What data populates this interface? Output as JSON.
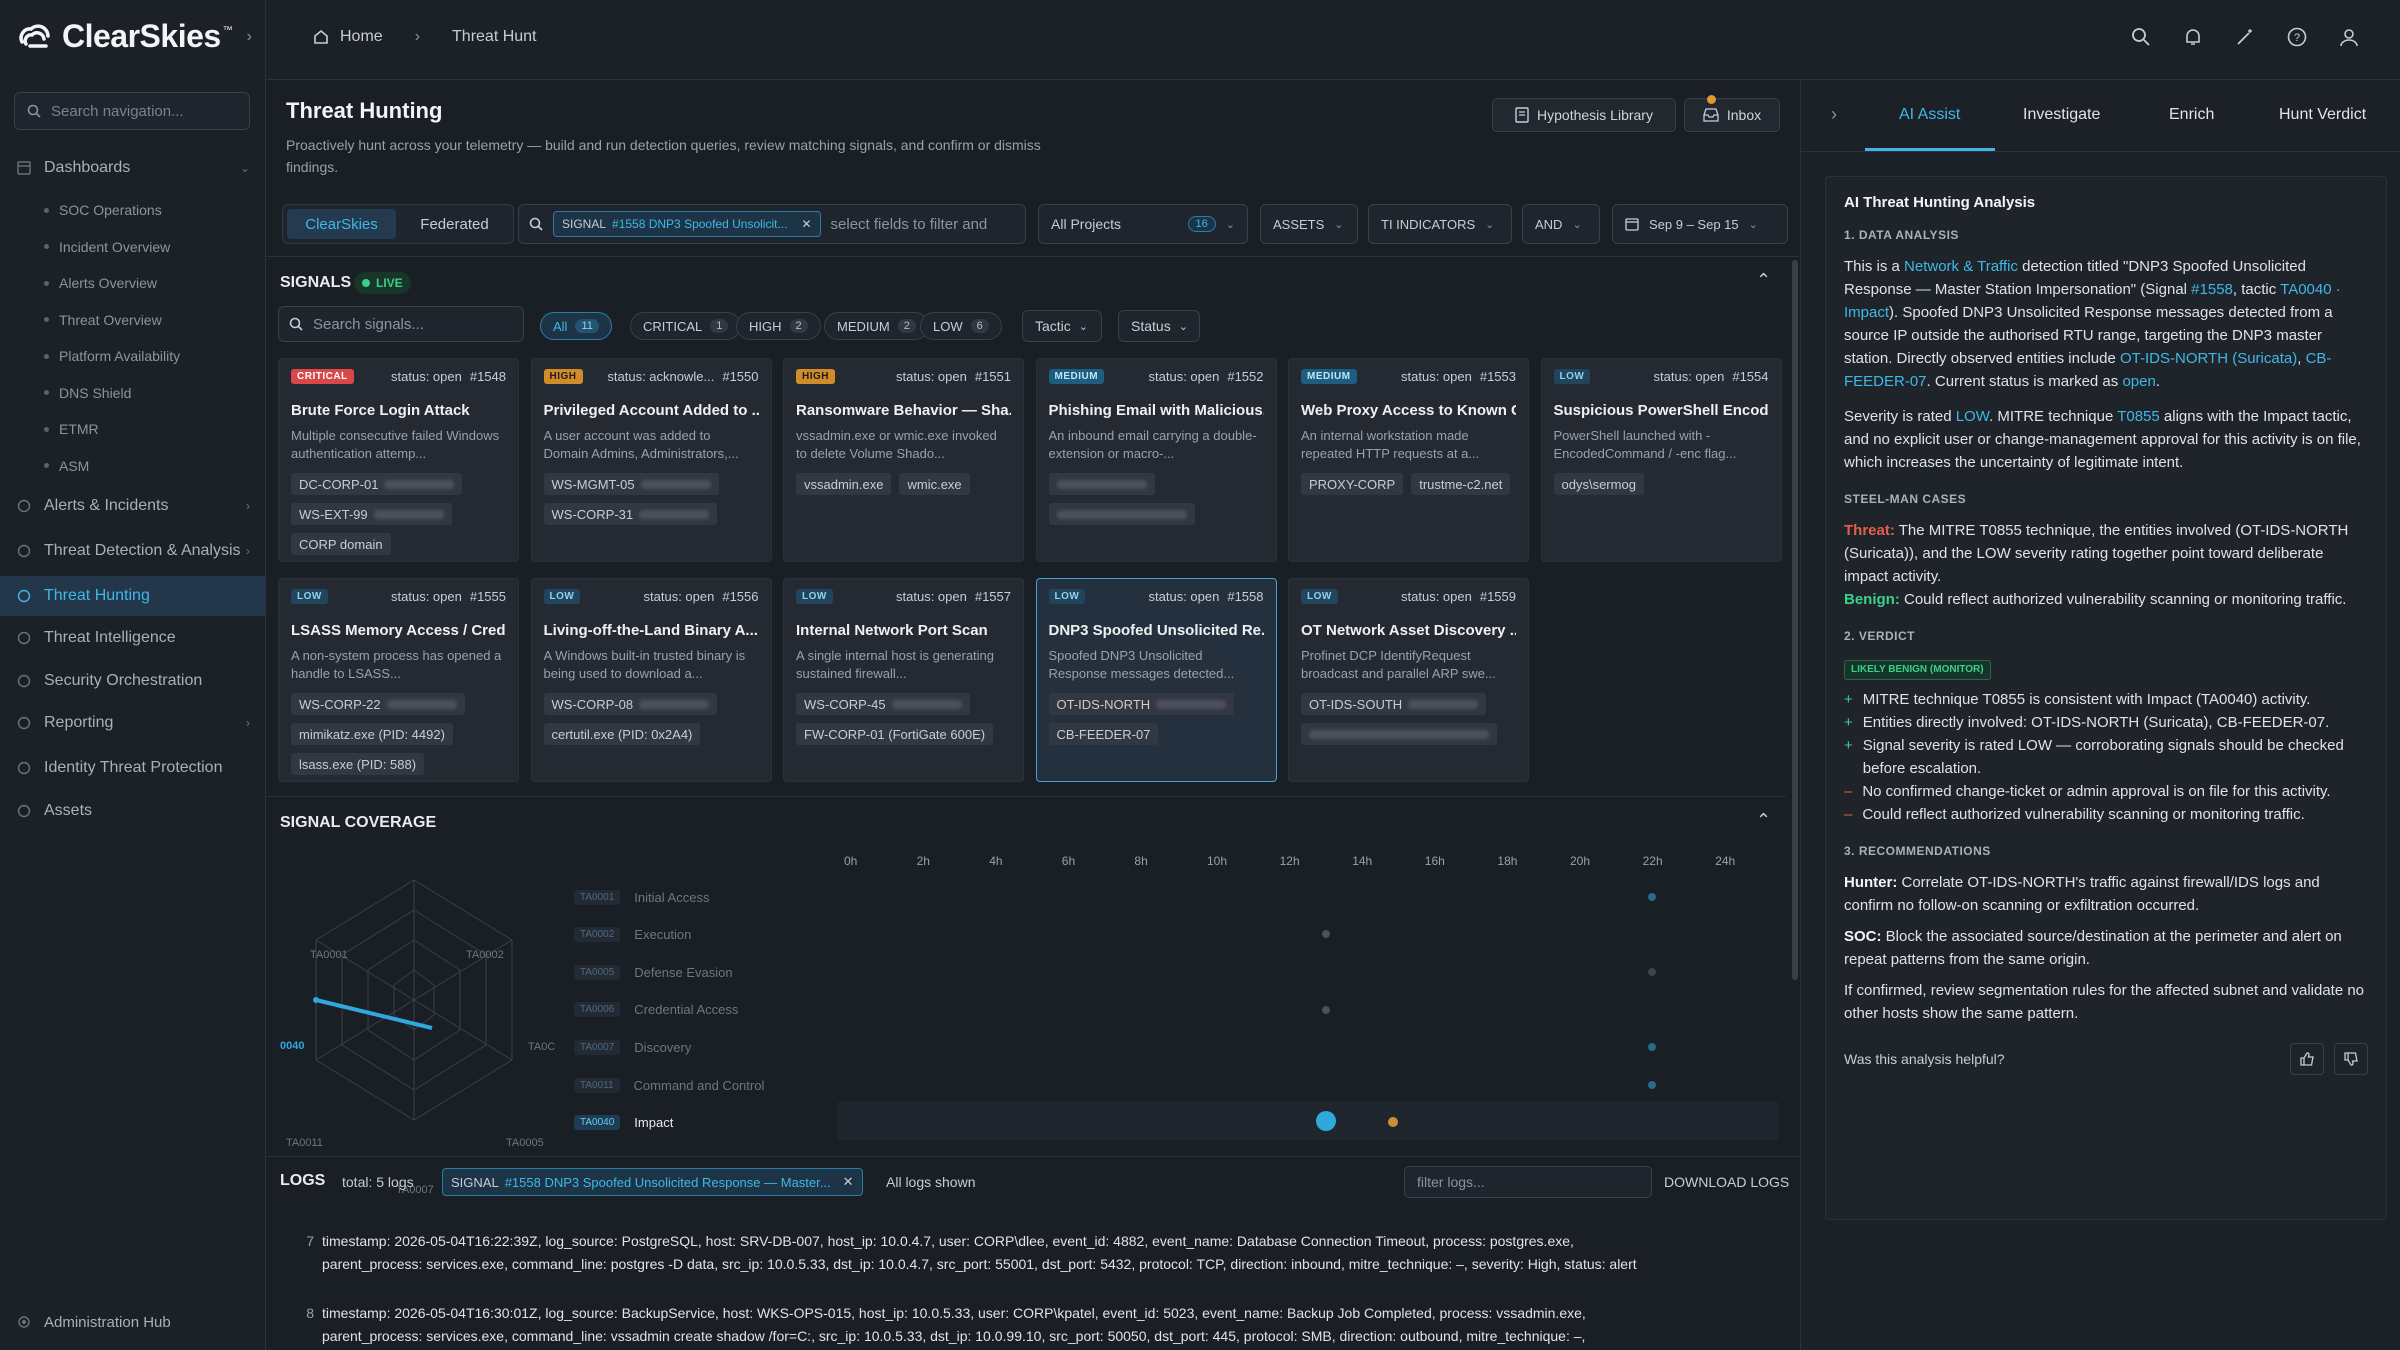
{
  "app": {
    "name": "ClearSkies",
    "tm": "™"
  },
  "nav": {
    "search_placeholder": "Search navigation...",
    "dashboards": "Dashboards",
    "dashboard_items": [
      "SOC Operations",
      "Incident Overview",
      "Alerts Overview",
      "Threat Overview",
      "Platform Availability",
      "DNS Shield",
      "ETMR",
      "ASM"
    ],
    "items": [
      "Alerts & Incidents",
      "Threat Detection & Analysis",
      "Threat Hunting",
      "Threat Intelligence",
      "Security Orchestration",
      "Reporting",
      "Identity Threat Protection",
      "Assets"
    ],
    "footer": "Administration Hub"
  },
  "breadcrumb": {
    "home": "Home",
    "current": "Threat Hunt"
  },
  "page": {
    "title": "Threat Hunting",
    "subtitle": "Proactively hunt across your telemetry — build and run detection queries, review matching signals, and confirm or dismiss findings.",
    "hypothesis_btn": "Hypothesis Library",
    "inbox_btn": "Inbox"
  },
  "filters": {
    "seg": [
      "ClearSkies",
      "Federated"
    ],
    "chip_key": "SIGNAL",
    "chip_val": "#1558 DNP3 Spoofed Unsolicit...",
    "filter_placeholder": "select fields to filter and",
    "projects": "All Projects",
    "projects_count": "16",
    "assets": "ASSETS",
    "ti": "TI INDICATORS",
    "and": "AND",
    "date": "Sep 9 – Sep 15"
  },
  "signals": {
    "title": "SIGNALS",
    "live": "LIVE",
    "search_placeholder": "Search signals...",
    "pills": [
      {
        "l": "All",
        "n": "11"
      },
      {
        "l": "CRITICAL",
        "n": "1"
      },
      {
        "l": "HIGH",
        "n": "2"
      },
      {
        "l": "MEDIUM",
        "n": "2"
      },
      {
        "l": "LOW",
        "n": "6"
      }
    ],
    "tactic": "Tactic",
    "status": "Status",
    "cards": [
      {
        "sev": "CRITICAL",
        "status": "status: open",
        "id": "#1548",
        "title": "Brute Force Login Attack",
        "desc": "Multiple consecutive failed Windows authentication attemp...",
        "ents": [
          "DC-CORP-01",
          "WS-EXT-99",
          "CORP domain"
        ]
      },
      {
        "sev": "HIGH",
        "status": "status: acknowle...",
        "id": "#1550",
        "title": "Privileged Account Added to ...",
        "desc": "A user account was added to Domain Admins, Administrators,...",
        "ents": [
          "WS-MGMT-05",
          "WS-CORP-31"
        ]
      },
      {
        "sev": "HIGH",
        "status": "status: open",
        "id": "#1551",
        "title": "Ransomware Behavior — Sha...",
        "desc": "vssadmin.exe or wmic.exe invoked to delete Volume Shado...",
        "ents": [
          "vssadmin.exe",
          "wmic.exe"
        ]
      },
      {
        "sev": "MEDIUM",
        "status": "status: open",
        "id": "#1552",
        "title": "Phishing Email with Malicious...",
        "desc": "An inbound email carrying a double-extension or macro-...",
        "ents": []
      },
      {
        "sev": "MEDIUM",
        "status": "status: open",
        "id": "#1553",
        "title": "Web Proxy Access to Known C...",
        "desc": "An internal workstation made repeated HTTP requests at a...",
        "ents": [
          "PROXY-CORP",
          "trustme-c2.net"
        ]
      },
      {
        "sev": "LOW",
        "status": "status: open",
        "id": "#1554",
        "title": "Suspicious PowerShell Encod...",
        "desc": "PowerShell launched with -EncodedCommand / -enc flag...",
        "ents": [
          "odys\\sermog"
        ]
      },
      {
        "sev": "LOW",
        "status": "status: open",
        "id": "#1555",
        "title": "LSASS Memory Access / Cred...",
        "desc": "A non-system process has opened a handle to LSASS...",
        "ents": [
          "WS-CORP-22",
          "mimikatz.exe (PID: 4492)",
          "lsass.exe (PID: 588)"
        ]
      },
      {
        "sev": "LOW",
        "status": "status: open",
        "id": "#1556",
        "title": "Living-off-the-Land Binary A...",
        "desc": "A Windows built-in trusted binary is being used to download a...",
        "ents": [
          "WS-CORP-08",
          "certutil.exe (PID: 0x2A4)"
        ]
      },
      {
        "sev": "LOW",
        "status": "status: open",
        "id": "#1557",
        "title": "Internal Network Port Scan",
        "desc": "A single internal host is generating sustained firewall...",
        "ents": [
          "WS-CORP-45",
          "FW-CORP-01 (FortiGate 600E)"
        ]
      },
      {
        "sev": "LOW",
        "status": "status: open",
        "id": "#1558",
        "title": "DNP3 Spoofed Unsolicited Re...",
        "desc": "Spoofed DNP3 Unsolicited Response messages detected...",
        "ents": [
          "OT-IDS-NORTH",
          "CB-FEEDER-07"
        ]
      },
      {
        "sev": "LOW",
        "status": "status: open",
        "id": "#1559",
        "title": "OT Network Asset Discovery ...",
        "desc": "Profinet DCP IdentifyRequest broadcast and parallel ARP swe...",
        "ents": [
          "OT-IDS-SOUTH"
        ]
      }
    ]
  },
  "coverage": {
    "title": "SIGNAL COVERAGE",
    "radar_labels": [
      "TA0001",
      "TA0002",
      "TA0C",
      "TA0005",
      "TA0007",
      "TA0011",
      "0040"
    ],
    "tactics": [
      {
        "code": "TA0001",
        "name": "Initial Access"
      },
      {
        "code": "TA0002",
        "name": "Execution"
      },
      {
        "code": "TA0005",
        "name": "Defense Evasion"
      },
      {
        "code": "TA0006",
        "name": "Credential Access"
      },
      {
        "code": "TA0007",
        "name": "Discovery"
      },
      {
        "code": "TA0011",
        "name": "Command and Control"
      },
      {
        "code": "TA0040",
        "name": "Impact"
      }
    ],
    "hours": [
      "0h",
      "2h",
      "4h",
      "6h",
      "8h",
      "10h",
      "12h",
      "14h",
      "16h",
      "18h",
      "20h",
      "22h",
      "24h"
    ]
  },
  "logs": {
    "title": "LOGS",
    "total": "total: 5 logs",
    "chip_key": "SIGNAL",
    "chip_val": "#1558  DNP3 Spoofed Unsolicited Response — Master...",
    "shown": "All logs shown",
    "filter_placeholder": "filter logs...",
    "download": "DOWNLOAD LOGS",
    "rows": [
      {
        "n": "7",
        "l1": "timestamp: 2026-05-04T16:22:39Z, log_source: PostgreSQL, host: SRV-DB-007, host_ip: 10.0.4.7, user: CORP\\dlee, event_id: 4882, event_name: Database Connection Timeout, process: postgres.exe,",
        "l2": "parent_process: services.exe, command_line: postgres -D data, src_ip: 10.0.5.33, dst_ip: 10.0.4.7, src_port: 55001, dst_port: 5432, protocol: TCP, direction: inbound, mitre_technique: –, severity: High, status: alert"
      },
      {
        "n": "8",
        "l1": "timestamp: 2026-05-04T16:30:01Z, log_source: BackupService, host: WKS-OPS-015, host_ip: 10.0.5.33, user: CORP\\kpatel, event_id: 5023, event_name: Backup Job Completed, process: vssadmin.exe,",
        "l2": "parent_process: services.exe, command_line: vssadmin create shadow /for=C:, src_ip: 10.0.5.33, dst_ip: 10.0.99.10, src_port: 50050, dst_port: 445, protocol: SMB, direction: outbound, mitre_technique: –,"
      }
    ]
  },
  "right": {
    "tabs": [
      "AI Assist",
      "Investigate",
      "Enrich",
      "Hunt Verdict"
    ],
    "heading": "AI Threat Hunting Analysis",
    "s1": "1. DATA ANALYSIS",
    "p1a": "This is a ",
    "p1b": "Network & Traffic",
    "p1c": " detection titled \"DNP3 Spoofed Unsolicited Response — Master Station Impersonation\" (Signal ",
    "p1d": "#1558",
    "p1e": ", tactic ",
    "p1f": "TA0040 · Impact",
    "p1g": "). Spoofed DNP3 Unsolicited Response messages detected from a source IP outside the authorised RTU range, targeting the DNP3 master station. Directly observed entities include ",
    "p1h": "OT-IDS-NORTH (Suricata)",
    "p1i": ", ",
    "p1j": "CB-FEEDER-07",
    "p1k": ". Current status is marked as ",
    "p1l": "open",
    "p1m": ".",
    "p2a": "Severity is rated ",
    "p2b": "LOW",
    "p2c": ". MITRE technique ",
    "p2d": "T0855",
    "p2e": " aligns with the Impact tactic, and no explicit user or change-management approval for this activity is on file, which increases the uncertainty of legitimate intent.",
    "s_steel": "STEEL-MAN CASES",
    "threat_lbl": "Threat:",
    "threat_txt": " The MITRE T0855 technique, the entities involved (OT-IDS-NORTH (Suricata)), and the LOW severity rating together point toward deliberate impact activity.",
    "benign_lbl": "Benign:",
    "benign_txt": " Could reflect authorized vulnerability scanning or monitoring traffic.",
    "s2": "2. VERDICT",
    "verdict_badge": "LIKELY BENIGN (MONITOR)",
    "bullets": [
      {
        "s": "+",
        "t": "MITRE technique T0855 is consistent with Impact (TA0040) activity."
      },
      {
        "s": "+",
        "t": "Entities directly involved: OT-IDS-NORTH (Suricata), CB-FEEDER-07."
      },
      {
        "s": "+",
        "t": "Signal severity is rated LOW — corroborating signals should be checked before escalation."
      },
      {
        "s": "–",
        "t": "No confirmed change-ticket or admin approval is on file for this activity."
      },
      {
        "s": "–",
        "t": "Could reflect authorized vulnerability scanning or monitoring traffic."
      }
    ],
    "s3": "3. RECOMMENDATIONS",
    "hunter_lbl": "Hunter:",
    "hunter_txt": " Correlate OT-IDS-NORTH's traffic against firewall/IDS logs and confirm no follow-on scanning or exfiltration occurred.",
    "soc_lbl": "SOC:",
    "soc_txt": " Block the associated source/destination at the perimeter and alert on repeat patterns from the same origin.",
    "p_final": "If confirmed, review segmentation rules for the affected subnet and validate no other hosts show the same pattern.",
    "helpful": "Was this analysis helpful?"
  },
  "colors": {
    "accent": "#3fb8e6",
    "critical": "#d94848",
    "high": "#d18c2a",
    "live": "#3ad08a"
  }
}
